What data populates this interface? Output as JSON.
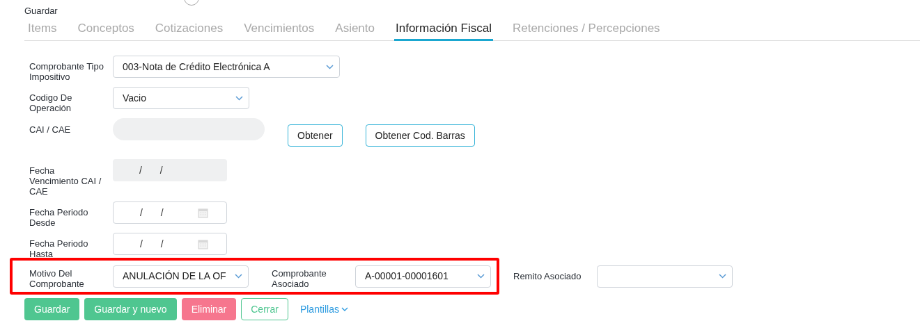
{
  "header": {
    "title": "Guardar"
  },
  "tabs": [
    {
      "label": "Items",
      "selected": false
    },
    {
      "label": "Conceptos",
      "selected": false
    },
    {
      "label": "Cotizaciones",
      "selected": false
    },
    {
      "label": "Vencimientos",
      "selected": false
    },
    {
      "label": "Asiento",
      "selected": false
    },
    {
      "label": "Información Fiscal",
      "selected": true
    },
    {
      "label": "Retenciones / Percepciones",
      "selected": false
    }
  ],
  "form": {
    "rows": [
      {
        "label": "Comprobante Tipo Impositivo",
        "kind": "select",
        "value": "003-Nota de Crédito Electrónica A"
      },
      {
        "label": "Codigo De Operación",
        "kind": "select",
        "value": "Vacio"
      },
      {
        "label": "CAI / CAE",
        "kind": "text",
        "disabled": true,
        "actions": [
          "Obtener",
          "Obtener Cod. Barras"
        ]
      },
      {
        "label": "Fecha Vencimiento CAI / CAE",
        "kind": "date",
        "value": "/ /",
        "disabled": true
      },
      {
        "label": "Fecha Periodo Desde",
        "kind": "date",
        "value": "/ /",
        "disabled": false
      },
      {
        "label": "Fecha Periodo Hasta",
        "kind": "date",
        "value": "/ /",
        "disabled": false
      }
    ],
    "highlighted": [
      {
        "label": "Motivo Del Comprobante",
        "value": "ANULACIÓN DE LA OF"
      },
      {
        "label": "Comprobante Asociado",
        "value": "A-00001-00001601"
      }
    ],
    "extra": {
      "label": "Remito Asociado"
    }
  },
  "buttons": [
    {
      "label": "Guardar",
      "kind": "primary"
    },
    {
      "label": "Guardar y nuevo",
      "kind": "primary"
    },
    {
      "label": "Eliminar",
      "kind": "danger"
    },
    {
      "label": "Cerrar",
      "kind": "outline"
    },
    {
      "label": "Plantillas",
      "kind": "dropdown"
    }
  ]
}
